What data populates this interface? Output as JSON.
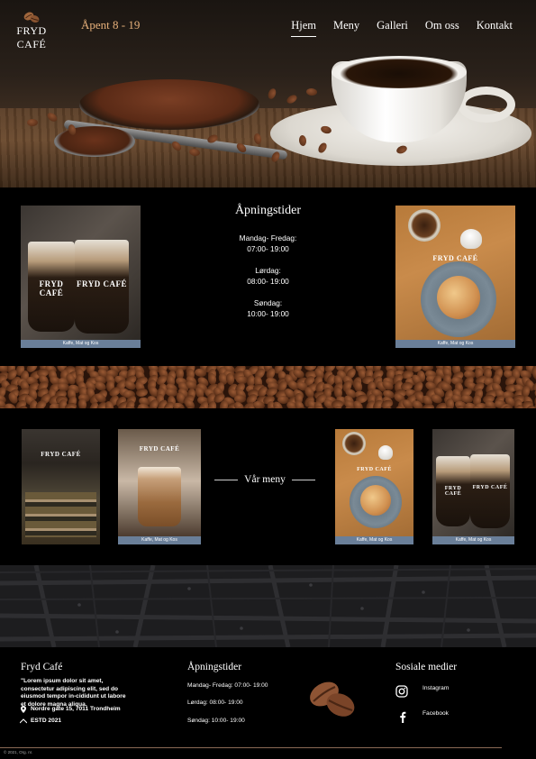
{
  "header": {
    "logo_text": "FRYD CAFÉ",
    "hours_tag": "Åpent 8 - 19",
    "nav": [
      {
        "label": "Hjem",
        "active": true
      },
      {
        "label": "Meny",
        "active": false
      },
      {
        "label": "Galleri",
        "active": false
      },
      {
        "label": "Om oss",
        "active": false
      },
      {
        "label": "Kontakt",
        "active": false
      }
    ]
  },
  "opening_hours": {
    "title": "Åpningstider",
    "weekdays_label": "Mandag- Fredag:",
    "weekdays_time": "07:00- 19:00",
    "saturday_label": "Lørdag:",
    "saturday_time": "08:00- 19:00",
    "sunday_label": "Søndag:",
    "sunday_time": "10:00- 19:00"
  },
  "photos": {
    "caption": "Kaffe, Mat og Kos",
    "brand": "FRYD CAFÉ"
  },
  "menu_section": {
    "title": "Vår meny"
  },
  "footer": {
    "cafe_name": "Fryd Café",
    "lorem": "\"Lorem ipsum dolor sit amet, consectetur adipiscing elit, sed do eiusmod tempor in-cididunt ut labore et dolore magna aliqua.",
    "address": "Nordre gate 15, 7011 Trondheim",
    "established": "ESTD 2021",
    "hours_title": "Åpningstider",
    "hours_weekdays": "Mandag- Fredag: 07:00- 19:00",
    "hours_saturday": "Lørdag: 08:00- 19:00",
    "hours_sunday": "Søndag: 10:00- 19:00",
    "social_title": "Sosiale medier",
    "instagram": "Instagram",
    "facebook": "Facebook",
    "copyright": "© 2021, Org. nr."
  },
  "colors": {
    "accent": "#e6b07a",
    "caption_bar": "#6a7f99",
    "background": "#000000"
  }
}
